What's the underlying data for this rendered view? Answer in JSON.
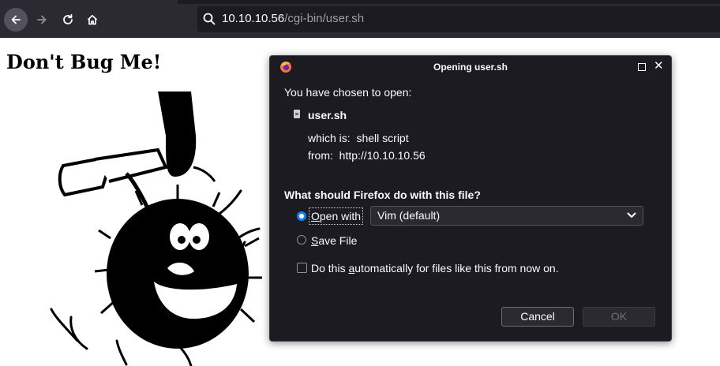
{
  "browser": {
    "url_host": "10.10.10.56",
    "url_path": "/cgi-bin/user.sh",
    "icons": [
      "back-icon",
      "forward-icon",
      "reload-icon",
      "home-icon",
      "search-icon"
    ]
  },
  "page": {
    "heading": "Don't Bug Me!",
    "image": "cartoon-bug-with-hammer"
  },
  "dialog": {
    "title": "Opening user.sh",
    "intro": "You have chosen to open:",
    "filename": "user.sh",
    "which_label": "which is:",
    "which_value": "shell script",
    "from_label": "from:",
    "from_value": "http://10.10.10.56",
    "question": "What should Firefox do with this file?",
    "open_with_mnemonic": "O",
    "open_with_rest": "pen with",
    "open_with_selected": true,
    "app_selected": "Vim (default)",
    "save_mnemonic": "S",
    "save_rest": "ave File",
    "auto_prefix": "Do this ",
    "auto_mnemonic": "a",
    "auto_rest": "utomatically for files like this from now on.",
    "auto_checked": false,
    "cancel_label": "Cancel",
    "ok_label": "OK",
    "colors": {
      "accent": "#0a84ff",
      "background": "#1c1b22",
      "text": "#fbfbfe"
    }
  }
}
